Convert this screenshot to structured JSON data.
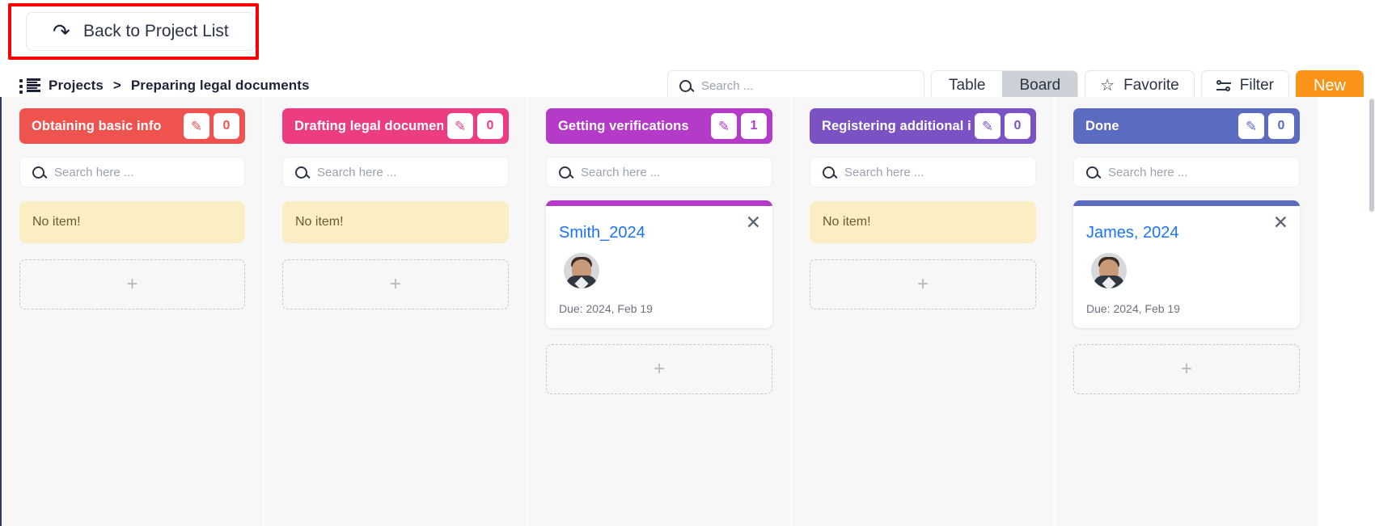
{
  "topbar": {
    "back_label": "Back to Project List",
    "back_icon": "undo-arrow-icon",
    "highlight_color": "#fb0000"
  },
  "breadcrumb": {
    "icon": "list-view-icon",
    "root": "Projects",
    "separator": ">",
    "current": "Preparing legal documents"
  },
  "toolbar": {
    "search_placeholder": "Search ...",
    "search_value": "",
    "view_tabs": [
      {
        "label": "Table",
        "active": false
      },
      {
        "label": "Board",
        "active": true
      }
    ],
    "favorite_label": "Favorite",
    "favorite_icon": "star-icon",
    "filter_label": "Filter",
    "filter_icon": "filter-sliders-icon",
    "new_label": "New",
    "new_color": "#fb9319"
  },
  "board": {
    "column_search_placeholder": "Search here ...",
    "empty_label": "No item!",
    "add_label": "+",
    "edit_icon": "pencil-icon",
    "close_icon": "close-x-icon",
    "columns": [
      {
        "title": "Obtaining basic info",
        "count": "0",
        "color": "#ef5350",
        "cards": []
      },
      {
        "title": "Drafting legal document",
        "count": "0",
        "color": "#ec3d83",
        "cards": []
      },
      {
        "title": "Getting verifications",
        "count": "1",
        "color": "#b43bc8",
        "cards": [
          {
            "title": "Smith_2024",
            "due": "Due: 2024, Feb 19",
            "avatar": "user-avatar",
            "stripe": "#b43bc8"
          }
        ]
      },
      {
        "title": "Registering additional info",
        "count": "0",
        "color": "#7b52c4",
        "cards": []
      },
      {
        "title": "Done",
        "count": "0",
        "color": "#5b6bc0",
        "cards": [
          {
            "title": "James, 2024",
            "due": "Due: 2024, Feb 19",
            "avatar": "user-avatar",
            "stripe": "#5b6bc0"
          }
        ]
      }
    ]
  }
}
